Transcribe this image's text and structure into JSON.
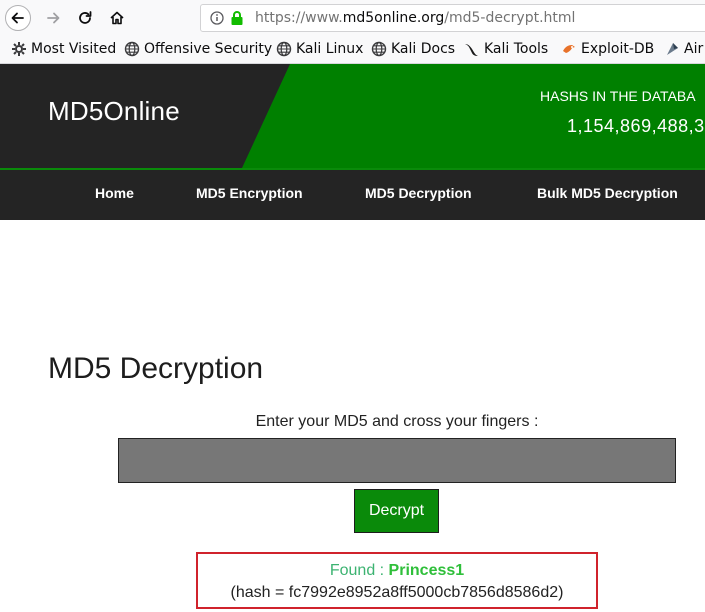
{
  "browser": {
    "url_prefix": "https://www.",
    "url_domain": "md5online.org",
    "url_path": "/md5-decrypt.html",
    "bookmarks": [
      {
        "label": "Most Visited",
        "icon": "gear-icon"
      },
      {
        "label": "Offensive Security",
        "icon": "globe-icon"
      },
      {
        "label": "Kali Linux",
        "icon": "globe-icon"
      },
      {
        "label": "Kali Docs",
        "icon": "globe-icon"
      },
      {
        "label": "Kali Tools",
        "icon": "kali-dragon-icon"
      },
      {
        "label": "Exploit-DB",
        "icon": "exploit-db-icon"
      },
      {
        "label": "Air",
        "icon": "aircrack-icon"
      }
    ]
  },
  "header": {
    "logo": "MD5Online",
    "hash_label": "HASHS IN THE DATABA",
    "hash_count": "1,154,869,488,3"
  },
  "nav": {
    "items": [
      "Home",
      "MD5 Encryption",
      "MD5 Decryption",
      "Bulk MD5 Decryption"
    ]
  },
  "main": {
    "title": "MD5 Decryption",
    "prompt": "Enter your MD5 and cross your fingers :",
    "input_value": "",
    "button_label": "Decrypt",
    "result": {
      "found_label": "Found : ",
      "password": "Princess1",
      "hash_text": "(hash = fc7992e8952a8ff5000cb7856d8586d2)"
    }
  },
  "colors": {
    "brand_green": "#008000",
    "header_dark": "#242424",
    "result_border": "#d0232c",
    "found_green": "#2fbf3a"
  }
}
